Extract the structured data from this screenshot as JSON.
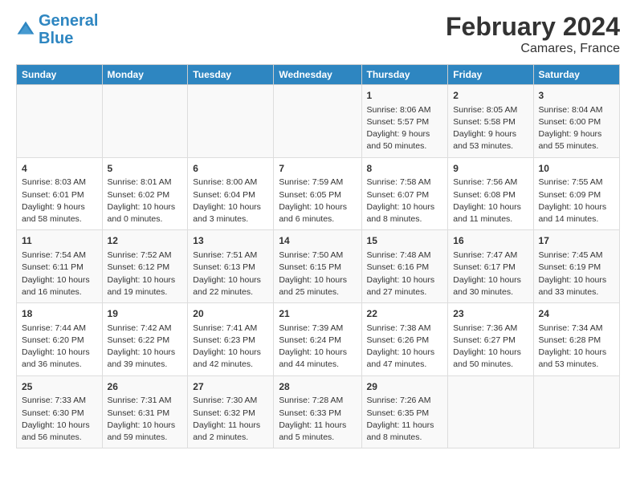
{
  "header": {
    "logo_line1": "General",
    "logo_line2": "Blue",
    "main_title": "February 2024",
    "subtitle": "Camares, France"
  },
  "columns": [
    "Sunday",
    "Monday",
    "Tuesday",
    "Wednesday",
    "Thursday",
    "Friday",
    "Saturday"
  ],
  "weeks": [
    [
      {
        "day": "",
        "info": ""
      },
      {
        "day": "",
        "info": ""
      },
      {
        "day": "",
        "info": ""
      },
      {
        "day": "",
        "info": ""
      },
      {
        "day": "1",
        "info": "Sunrise: 8:06 AM\nSunset: 5:57 PM\nDaylight: 9 hours\nand 50 minutes."
      },
      {
        "day": "2",
        "info": "Sunrise: 8:05 AM\nSunset: 5:58 PM\nDaylight: 9 hours\nand 53 minutes."
      },
      {
        "day": "3",
        "info": "Sunrise: 8:04 AM\nSunset: 6:00 PM\nDaylight: 9 hours\nand 55 minutes."
      }
    ],
    [
      {
        "day": "4",
        "info": "Sunrise: 8:03 AM\nSunset: 6:01 PM\nDaylight: 9 hours\nand 58 minutes."
      },
      {
        "day": "5",
        "info": "Sunrise: 8:01 AM\nSunset: 6:02 PM\nDaylight: 10 hours\nand 0 minutes."
      },
      {
        "day": "6",
        "info": "Sunrise: 8:00 AM\nSunset: 6:04 PM\nDaylight: 10 hours\nand 3 minutes."
      },
      {
        "day": "7",
        "info": "Sunrise: 7:59 AM\nSunset: 6:05 PM\nDaylight: 10 hours\nand 6 minutes."
      },
      {
        "day": "8",
        "info": "Sunrise: 7:58 AM\nSunset: 6:07 PM\nDaylight: 10 hours\nand 8 minutes."
      },
      {
        "day": "9",
        "info": "Sunrise: 7:56 AM\nSunset: 6:08 PM\nDaylight: 10 hours\nand 11 minutes."
      },
      {
        "day": "10",
        "info": "Sunrise: 7:55 AM\nSunset: 6:09 PM\nDaylight: 10 hours\nand 14 minutes."
      }
    ],
    [
      {
        "day": "11",
        "info": "Sunrise: 7:54 AM\nSunset: 6:11 PM\nDaylight: 10 hours\nand 16 minutes."
      },
      {
        "day": "12",
        "info": "Sunrise: 7:52 AM\nSunset: 6:12 PM\nDaylight: 10 hours\nand 19 minutes."
      },
      {
        "day": "13",
        "info": "Sunrise: 7:51 AM\nSunset: 6:13 PM\nDaylight: 10 hours\nand 22 minutes."
      },
      {
        "day": "14",
        "info": "Sunrise: 7:50 AM\nSunset: 6:15 PM\nDaylight: 10 hours\nand 25 minutes."
      },
      {
        "day": "15",
        "info": "Sunrise: 7:48 AM\nSunset: 6:16 PM\nDaylight: 10 hours\nand 27 minutes."
      },
      {
        "day": "16",
        "info": "Sunrise: 7:47 AM\nSunset: 6:17 PM\nDaylight: 10 hours\nand 30 minutes."
      },
      {
        "day": "17",
        "info": "Sunrise: 7:45 AM\nSunset: 6:19 PM\nDaylight: 10 hours\nand 33 minutes."
      }
    ],
    [
      {
        "day": "18",
        "info": "Sunrise: 7:44 AM\nSunset: 6:20 PM\nDaylight: 10 hours\nand 36 minutes."
      },
      {
        "day": "19",
        "info": "Sunrise: 7:42 AM\nSunset: 6:22 PM\nDaylight: 10 hours\nand 39 minutes."
      },
      {
        "day": "20",
        "info": "Sunrise: 7:41 AM\nSunset: 6:23 PM\nDaylight: 10 hours\nand 42 minutes."
      },
      {
        "day": "21",
        "info": "Sunrise: 7:39 AM\nSunset: 6:24 PM\nDaylight: 10 hours\nand 44 minutes."
      },
      {
        "day": "22",
        "info": "Sunrise: 7:38 AM\nSunset: 6:26 PM\nDaylight: 10 hours\nand 47 minutes."
      },
      {
        "day": "23",
        "info": "Sunrise: 7:36 AM\nSunset: 6:27 PM\nDaylight: 10 hours\nand 50 minutes."
      },
      {
        "day": "24",
        "info": "Sunrise: 7:34 AM\nSunset: 6:28 PM\nDaylight: 10 hours\nand 53 minutes."
      }
    ],
    [
      {
        "day": "25",
        "info": "Sunrise: 7:33 AM\nSunset: 6:30 PM\nDaylight: 10 hours\nand 56 minutes."
      },
      {
        "day": "26",
        "info": "Sunrise: 7:31 AM\nSunset: 6:31 PM\nDaylight: 10 hours\nand 59 minutes."
      },
      {
        "day": "27",
        "info": "Sunrise: 7:30 AM\nSunset: 6:32 PM\nDaylight: 11 hours\nand 2 minutes."
      },
      {
        "day": "28",
        "info": "Sunrise: 7:28 AM\nSunset: 6:33 PM\nDaylight: 11 hours\nand 5 minutes."
      },
      {
        "day": "29",
        "info": "Sunrise: 7:26 AM\nSunset: 6:35 PM\nDaylight: 11 hours\nand 8 minutes."
      },
      {
        "day": "",
        "info": ""
      },
      {
        "day": "",
        "info": ""
      }
    ]
  ]
}
